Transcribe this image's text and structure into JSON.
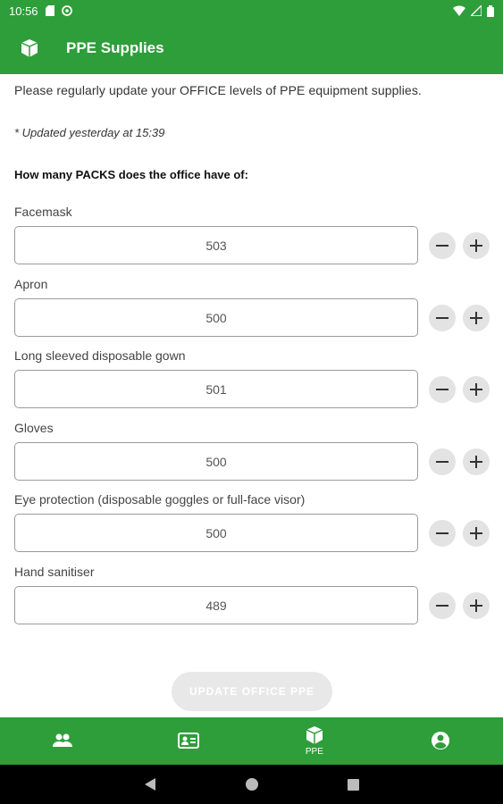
{
  "status_bar": {
    "time": "10:56"
  },
  "app_bar": {
    "title": "PPE Supplies",
    "icon": "box-icon"
  },
  "intro": "Please regularly update your OFFICE levels of PPE equipment supplies.",
  "updated": "* Updated yesterday at 15:39",
  "question": "How many PACKS does the office have of:",
  "items": [
    {
      "label": "Facemask",
      "value": "503"
    },
    {
      "label": "Apron",
      "value": "500"
    },
    {
      "label": "Long sleeved disposable gown",
      "value": "501"
    },
    {
      "label": "Gloves",
      "value": "500"
    },
    {
      "label": "Eye protection (disposable goggles or full-face visor)",
      "value": "500"
    },
    {
      "label": "Hand sanitiser",
      "value": "489"
    }
  ],
  "update_button": "UPDATE OFFICE PPE",
  "bottom_nav": [
    {
      "icon": "people-icon",
      "label": ""
    },
    {
      "icon": "id-card-icon",
      "label": ""
    },
    {
      "icon": "box-icon",
      "label": "PPE"
    },
    {
      "icon": "account-icon",
      "label": ""
    }
  ],
  "colors": {
    "brand": "#2e9e3a",
    "button_disabled": "#e8e8e8"
  }
}
